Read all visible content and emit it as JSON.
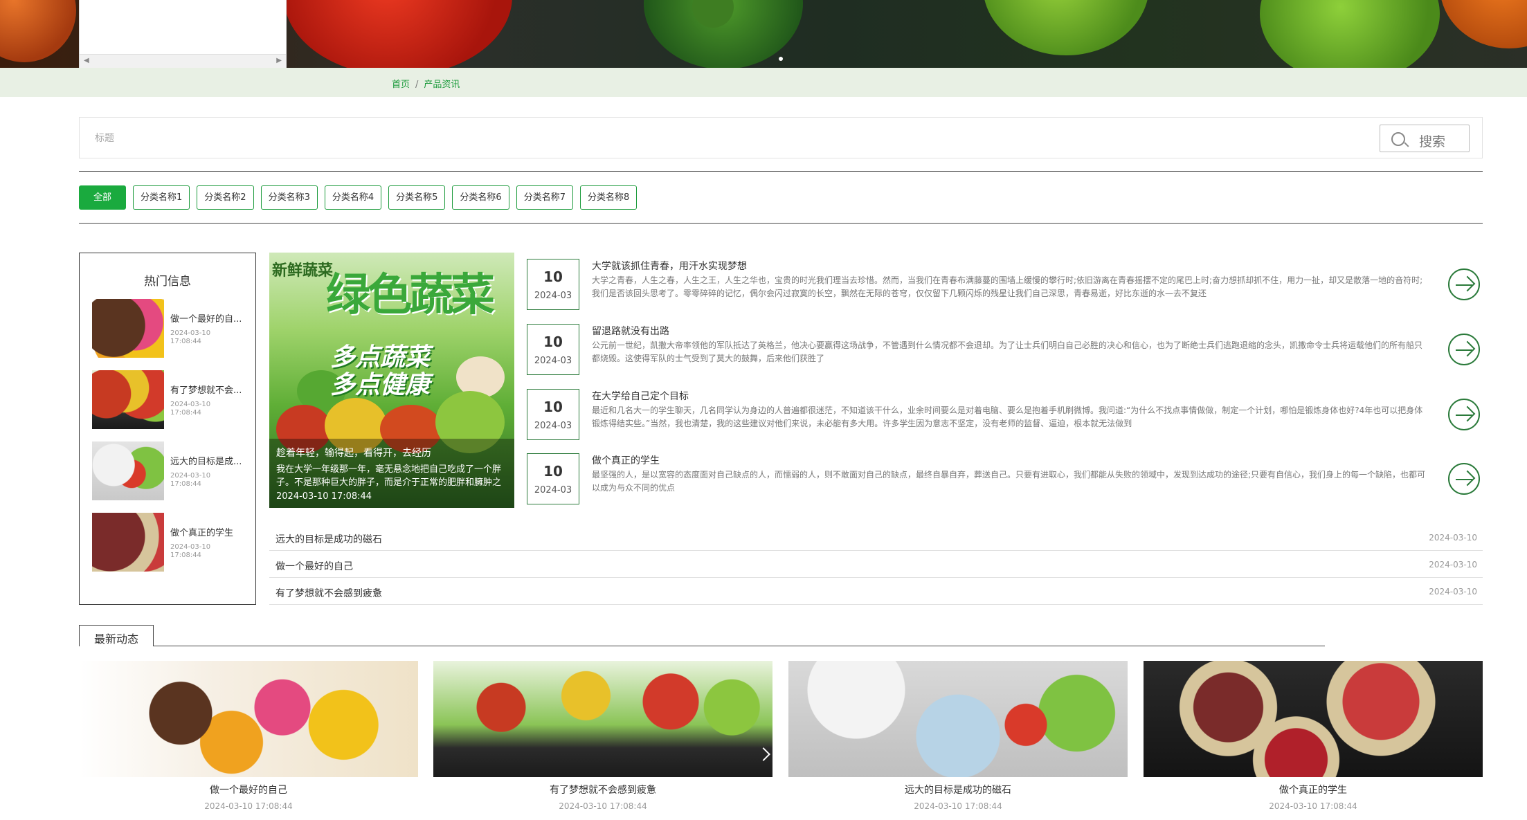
{
  "breadcrumb": {
    "home": "首页",
    "separator": "/",
    "current": "产品资讯"
  },
  "search": {
    "placeholder": "标题",
    "button_label": "搜索"
  },
  "categories": [
    "全部",
    "分类名称1",
    "分类名称2",
    "分类名称3",
    "分类名称4",
    "分类名称5",
    "分类名称6",
    "分类名称7",
    "分类名称8"
  ],
  "hot": {
    "title": "热门信息",
    "items": [
      {
        "title": "做一个最好的自...",
        "date": "2024-03-10",
        "time": "17:08:44"
      },
      {
        "title": "有了梦想就不会...",
        "date": "2024-03-10",
        "time": "17:08:44"
      },
      {
        "title": "远大的目标是成...",
        "date": "2024-03-10",
        "time": "17:08:44"
      },
      {
        "title": "做个真正的学生",
        "date": "2024-03-10",
        "time": "17:08:44"
      }
    ]
  },
  "feature": {
    "corner_text": "新鲜蔬菜",
    "headline": "绿色蔬菜",
    "subline_1": "多点蔬菜",
    "subline_2": "多点健康",
    "title": "趁着年轻，输得起，看得开，去经历",
    "desc": "我在大学一年级那一年，毫无悬念地把自己吃成了一个胖子。不是那种巨大的胖子，而是介于正常的肥胖和臃肿之间的胖子",
    "date": "2024-03-10 17:08:44"
  },
  "news": [
    {
      "day": "10",
      "ym": "2024-03",
      "title": "大学就该抓住青春，用汗水实现梦想",
      "desc": "大学之青春，人生之春，人生之王，人生之华也，宝贵的时光我们理当去珍惜。然而，当我们在青春布满藤蔓的围墙上缓慢的攀行时;依旧游离在青春摇摆不定的尾巴上时;奋力想抓却抓不住，用力一扯，却又是散落一地的音符时;我们是否该回头思考了。零零碎碎的记忆，偶尔会闪过寂寞的长空，飘然在无际的苍穹，仅仅留下几颗闪烁的残星让我们自己深思，青春易逝，好比东逝的水—去不复还"
    },
    {
      "day": "10",
      "ym": "2024-03",
      "title": "留退路就没有出路",
      "desc": "公元前一世纪，凯撒大帝率领他的军队抵达了英格兰，他决心要赢得这场战争，不管遇到什么情况都不会退却。为了让士兵们明白自己必胜的决心和信心，也为了断绝士兵们逃跑退缩的念头，凯撒命令士兵将运载他们的所有船只都烧毁。这使得军队的士气受到了莫大的鼓舞，后来他们获胜了"
    },
    {
      "day": "10",
      "ym": "2024-03",
      "title": "在大学给自己定个目标",
      "desc": "最近和几名大一的学生聊天，几名同学认为身边的人普遍都很迷茫，不知道该干什么，业余时间要么是对着电脑、要么是抱着手机刷微博。我问道:“为什么不找点事情做做，制定一个计划，哪怕是锻炼身体也好?4年也可以把身体锻炼得结实些。”当然，我也清楚，我的这些建议对他们来说，未必能有多大用。许多学生因为意志不坚定，没有老师的监督、逼迫，根本就无法做到"
    },
    {
      "day": "10",
      "ym": "2024-03",
      "title": "做个真正的学生",
      "desc": "最坚强的人，是以宽容的态度面对自己缺点的人，而懦弱的人，则不敢面对自己的缺点，最终自暴自弃，葬送自己。只要有进取心，我们都能从失败的领域中，发现到达成功的途径;只要有自信心，我们身上的每一个缺陷，也都可以成为与众不同的优点"
    }
  ],
  "links": [
    {
      "title": "远大的目标是成功的磁石",
      "date": "2024-03-10"
    },
    {
      "title": "做一个最好的自己",
      "date": "2024-03-10"
    },
    {
      "title": "有了梦想就不会感到疲惫",
      "date": "2024-03-10"
    }
  ],
  "latest": {
    "tab": "最新动态",
    "cards": [
      {
        "title": "做一个最好的自己",
        "date": "2024-03-10 17:08:44"
      },
      {
        "title": "有了梦想就不会感到疲惫",
        "date": "2024-03-10 17:08:44"
      },
      {
        "title": "远大的目标是成功的磁石",
        "date": "2024-03-10 17:08:44"
      },
      {
        "title": "做个真正的学生",
        "date": "2024-03-10 17:08:44"
      }
    ]
  },
  "colors": {
    "accent": "#1aaa3e",
    "dark_green": "#2a7a3a",
    "crumb_bg": "#e8f0e4"
  }
}
